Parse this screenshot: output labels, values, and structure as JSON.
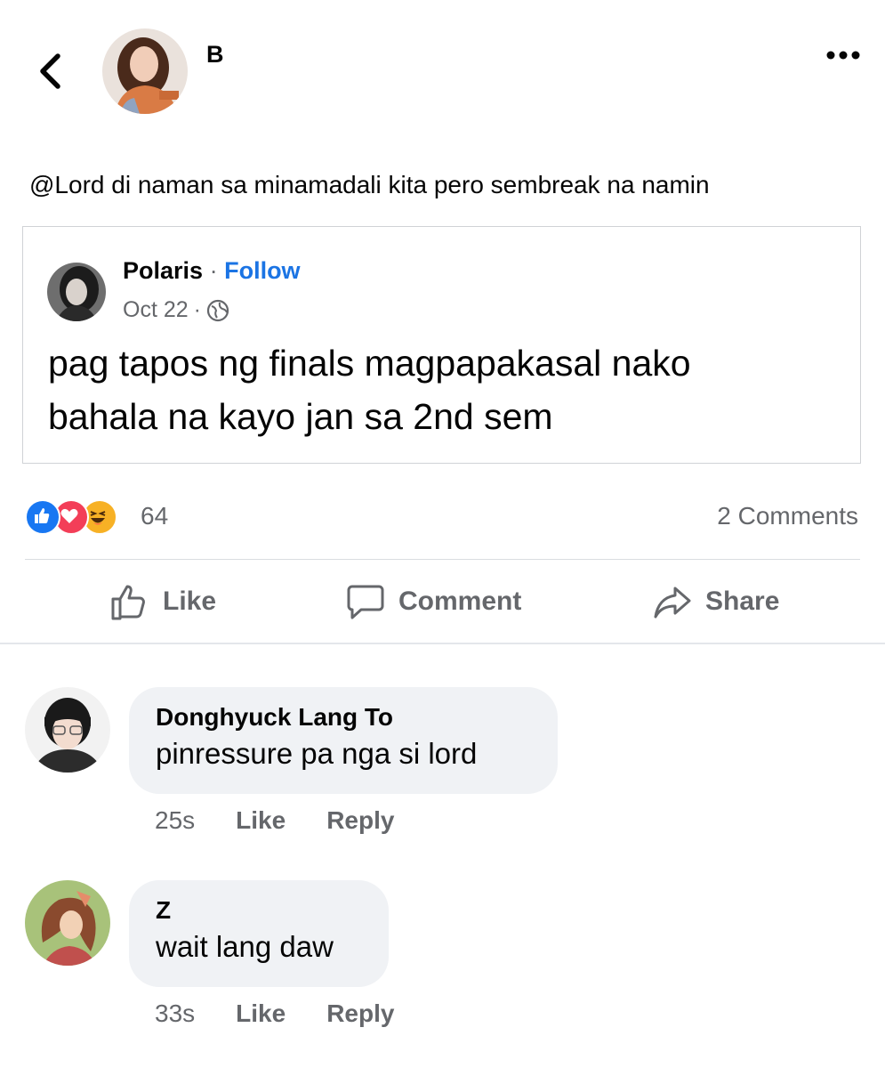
{
  "header": {
    "back_icon": "chevron-left-icon",
    "poster_name": "B",
    "more_icon": "ellipsis-icon"
  },
  "post": {
    "text": "@Lord di naman sa minamadali kita pero sembreak na namin"
  },
  "shared_post": {
    "author": "Polaris",
    "separator": "·",
    "follow_label": "Follow",
    "date": "Oct 22",
    "meta_separator": "·",
    "audience_icon": "globe-icon",
    "text_line1": "pag tapos ng finals magpapakasal nako",
    "text_line2": "bahala na kayo jan sa 2nd sem"
  },
  "reactions": {
    "types": [
      "like",
      "love",
      "haha"
    ],
    "count": "64",
    "comments": "2 Comments"
  },
  "actions": {
    "like": "Like",
    "comment": "Comment",
    "share": "Share"
  },
  "comments": [
    {
      "name": "Donghyuck Lang To",
      "text": "pinressure pa nga si lord",
      "time": "25s",
      "like": "Like",
      "reply": "Reply"
    },
    {
      "name": "Z",
      "text": "wait lang daw",
      "time": "33s",
      "like": "Like",
      "reply": "Reply"
    }
  ],
  "colors": {
    "link": "#1b74e4",
    "muted": "#65676b",
    "bubble": "#f0f2f5",
    "like": "#1877f2",
    "love": "#f33e58",
    "haha": "#f7b125"
  }
}
